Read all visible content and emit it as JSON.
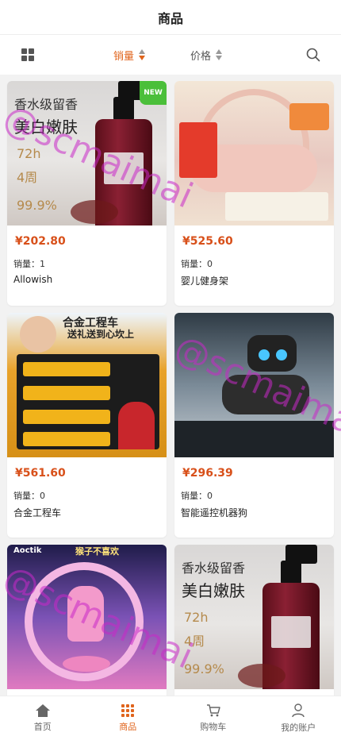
{
  "header": {
    "title": "商品"
  },
  "filter": {
    "sort_sales": "销量",
    "sort_price": "价格",
    "active_sort": "销量",
    "accent": "#e0641c"
  },
  "products": [
    {
      "price": "¥202.80",
      "sales_label": "销量：",
      "sales": "1",
      "name": "Allowish",
      "badge": "NEW",
      "image_text": {
        "line1": "香水级留香",
        "line2": "美白嫩肤",
        "s1": "72h",
        "s2": "4周",
        "s3": "99.9%"
      }
    },
    {
      "price": "¥525.60",
      "sales_label": "销量：",
      "sales": "0",
      "name": "婴儿健身架"
    },
    {
      "price": "¥561.60",
      "sales_label": "销量：",
      "sales": "0",
      "name": "合金工程车",
      "image_text": {
        "title": "合金工程车",
        "subtitle": "送礼送到心坎上"
      }
    },
    {
      "price": "¥296.39",
      "sales_label": "销量：",
      "sales": "0",
      "name": "智能遥控机器狗"
    },
    {
      "image_text": {
        "brand": "Aoctik",
        "title": "猴子不喜欢"
      }
    },
    {
      "image_text": {
        "line1": "香水级留香",
        "line2": "美白嫩肤",
        "s1": "72h",
        "s2": "4周",
        "s3": "99.9%"
      }
    }
  ],
  "watermark": "@scmaimai",
  "tabbar": [
    {
      "label": "首页",
      "icon": "home-icon",
      "active": false
    },
    {
      "label": "商品",
      "icon": "grid-icon",
      "active": true
    },
    {
      "label": "购物车",
      "icon": "cart-icon",
      "active": false
    },
    {
      "label": "我的账户",
      "icon": "user-icon",
      "active": false
    }
  ]
}
